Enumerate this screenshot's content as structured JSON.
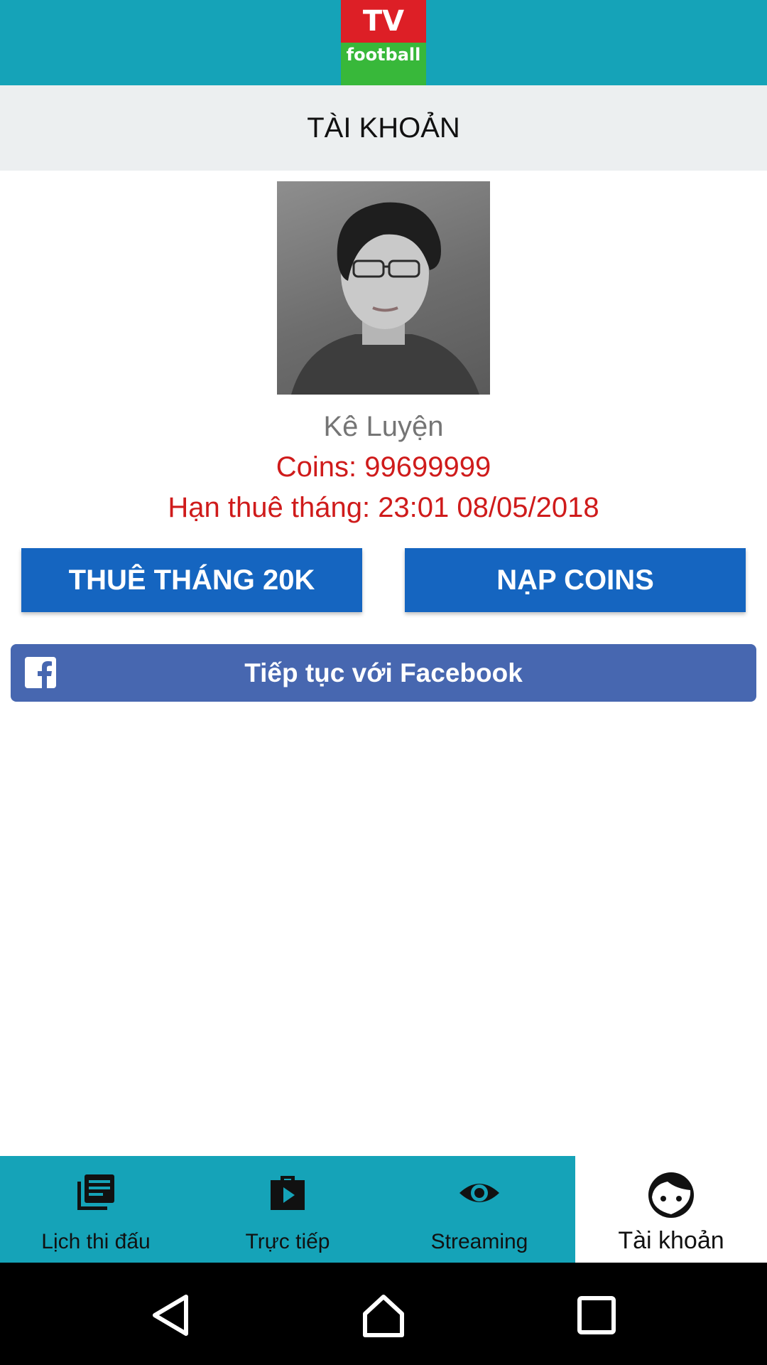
{
  "app": {
    "logo_top": "TV",
    "logo_bottom": "football",
    "brand_colors": {
      "header": "#15a3b8",
      "logo_red": "#dd1f26",
      "logo_green": "#38b83a"
    }
  },
  "header": {
    "title": "TÀI KHOẢN"
  },
  "profile": {
    "avatar_icon": "user-photo",
    "name": "Kê Luyện",
    "coins": "Coins: 99699999",
    "expiry": "Hạn thuê tháng: 23:01 08/05/2018"
  },
  "actions": {
    "rent_label": "THUÊ THÁNG 20K",
    "topup_label": "NẠP COINS",
    "facebook_label": "Tiếp tục với Facebook",
    "button_color": "#1565c0",
    "facebook_color": "#4767b0"
  },
  "bottom_nav": {
    "items": [
      {
        "label": "Lịch thi đấu",
        "icon": "schedule-icon",
        "active": false
      },
      {
        "label": "Trực tiếp",
        "icon": "live-play-icon",
        "active": false
      },
      {
        "label": "Streaming",
        "icon": "eye-icon",
        "active": false
      },
      {
        "label": "Tài khoản",
        "icon": "face-icon",
        "active": true
      }
    ]
  },
  "system_nav": {
    "buttons": [
      "back-icon",
      "home-icon",
      "recents-icon"
    ]
  }
}
